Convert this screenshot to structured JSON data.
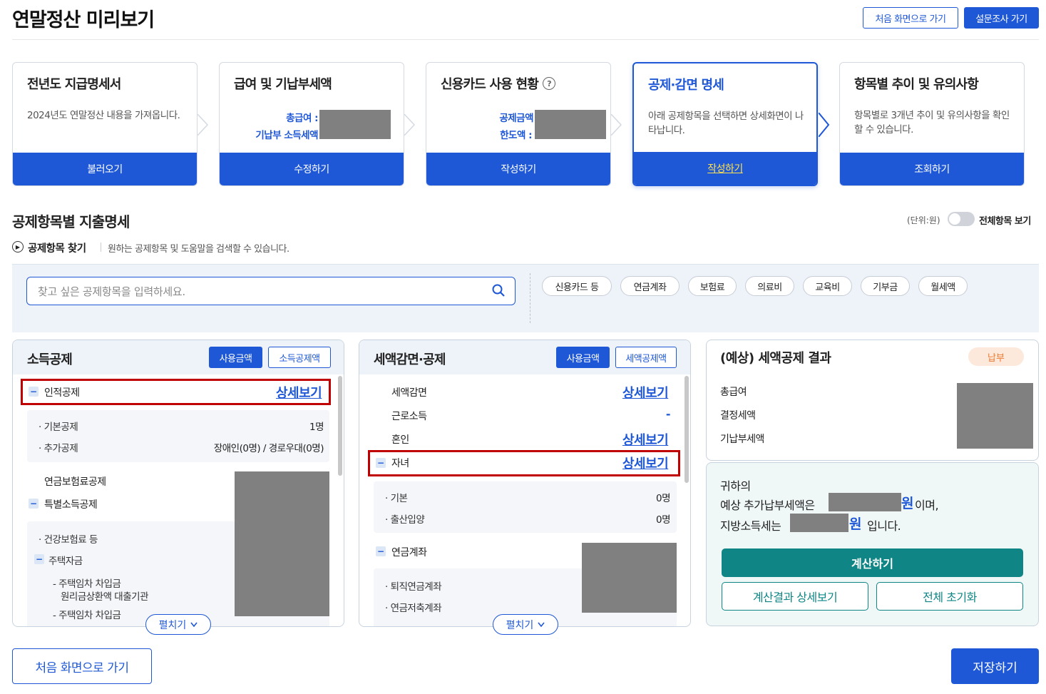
{
  "page_title": "연말정산 미리보기",
  "header": {
    "home_button": "처음 화면으로 가기",
    "survey_button": "설문조사 가기"
  },
  "steps": [
    {
      "title": "전년도 지급명세서",
      "desc": "2024년도 연말정산 내용을 가져옵니다.",
      "button": "불러오기"
    },
    {
      "title": "급여 및 기납부세액",
      "kv1": "총급여 :",
      "kv2": "기납부 소득세액",
      "button": "수정하기"
    },
    {
      "title": "신용카드 사용 현황",
      "help": "?",
      "kv1": "공제금액",
      "kv2": "한도액 :",
      "button": "작성하기"
    },
    {
      "title": "공제·감면 명세",
      "desc": "아래 공제항목을 선택하면 상세화면이 나타납니다.",
      "button": "작성하기"
    },
    {
      "title": "항목별 추이 및 유의사항",
      "desc": "항목별로 3개년 추이 및 유의사항을 확인할 수 있습니다.",
      "button": "조회하기"
    }
  ],
  "section": {
    "title": "공제항목별 지출명세",
    "unit": "(단위:원)",
    "toggle_label": "전체항목 보기"
  },
  "finder": {
    "title": "공제항목 찾기",
    "desc": "원하는 공제항목 및 도움말을 검색할 수 있습니다.",
    "placeholder": "찾고 싶은 공제항목을 입력하세요."
  },
  "chips": [
    "신용카드 등",
    "연금계좌",
    "보험료",
    "의료비",
    "교육비",
    "기부금",
    "월세액"
  ],
  "income_panel": {
    "title": "소득공제",
    "tab_on": "사용금액",
    "tab_off": "소득공제액",
    "personal": "인적공제",
    "detail": "상세보기",
    "sub": [
      {
        "label": "기본공제",
        "value": "1명"
      },
      {
        "label": "추가공제",
        "value": "장애인(0명) / 경로우대(0명)"
      }
    ],
    "pension": "연금보험료공제",
    "special": "특별소득공제",
    "health": "건강보험료 등",
    "housing": "주택자금",
    "loan1": "주택임차 차입금",
    "loan1b": "원리금상환액 대출기관",
    "loan2": "주택임차 차입금",
    "expand": "펼치기"
  },
  "tax_panel": {
    "title": "세액감면·공제",
    "tab_on": "사용금액",
    "tab_off": "세액공제액",
    "reduction": "세액감면",
    "detail": "상세보기",
    "earned": "근로소득",
    "earned_value": "-",
    "marriage": "혼인",
    "child": "자녀",
    "sub": [
      {
        "label": "기본",
        "value": "0명"
      },
      {
        "label": "출산입양",
        "value": "0명"
      }
    ],
    "pension_acct": "연금계좌",
    "retire": "퇴직연금계좌",
    "savings": "연금저축계좌",
    "expand": "펼치기"
  },
  "result": {
    "title": "(예상) 세액공제 결과",
    "badge": "납부",
    "rows": [
      "총급여",
      "결정세액",
      "기납부세액"
    ],
    "line1": "귀하의",
    "line2a": "예상 추가납부세액은",
    "won": "원",
    "line2b": "이며,",
    "line3a": "지방소득세는",
    "line3b": "입니다.",
    "calc": "계산하기",
    "detail_btn": "계산결과 상세보기",
    "reset_btn": "전체 초기화"
  },
  "footer": {
    "home": "처음 화면으로 가기",
    "save": "저장하기"
  },
  "colors": {
    "primary": "#1f58d6",
    "teal": "#0f8585",
    "highlight": "#c00000",
    "mask": "#808080"
  }
}
